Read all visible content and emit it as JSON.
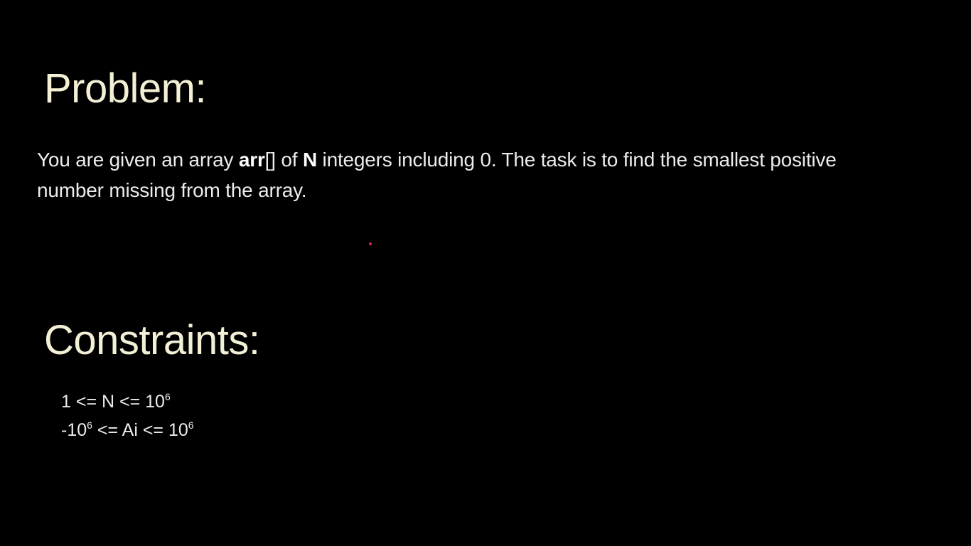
{
  "slide": {
    "problem_heading": "Problem:",
    "problem_text": {
      "part1": "You are given an array ",
      "arr": "arr",
      "part2": "[] of ",
      "n": "N",
      "part3": " integers including 0. The task is to find the smallest positive number missing from the array."
    },
    "constraints_heading": "Constraints:",
    "constraints": [
      {
        "prefix": "1 <= N <= 10",
        "exp1": "6",
        "mid": "",
        "exp2": "",
        "suffix": ""
      },
      {
        "prefix": "-10",
        "exp1": "6",
        "mid": " <= Ai <= 10",
        "exp2": "6",
        "suffix": ""
      }
    ]
  },
  "colors": {
    "background": "#000000",
    "heading": "#f4f0d6",
    "body_text": "#ececec",
    "pointer": "#e0204a"
  }
}
